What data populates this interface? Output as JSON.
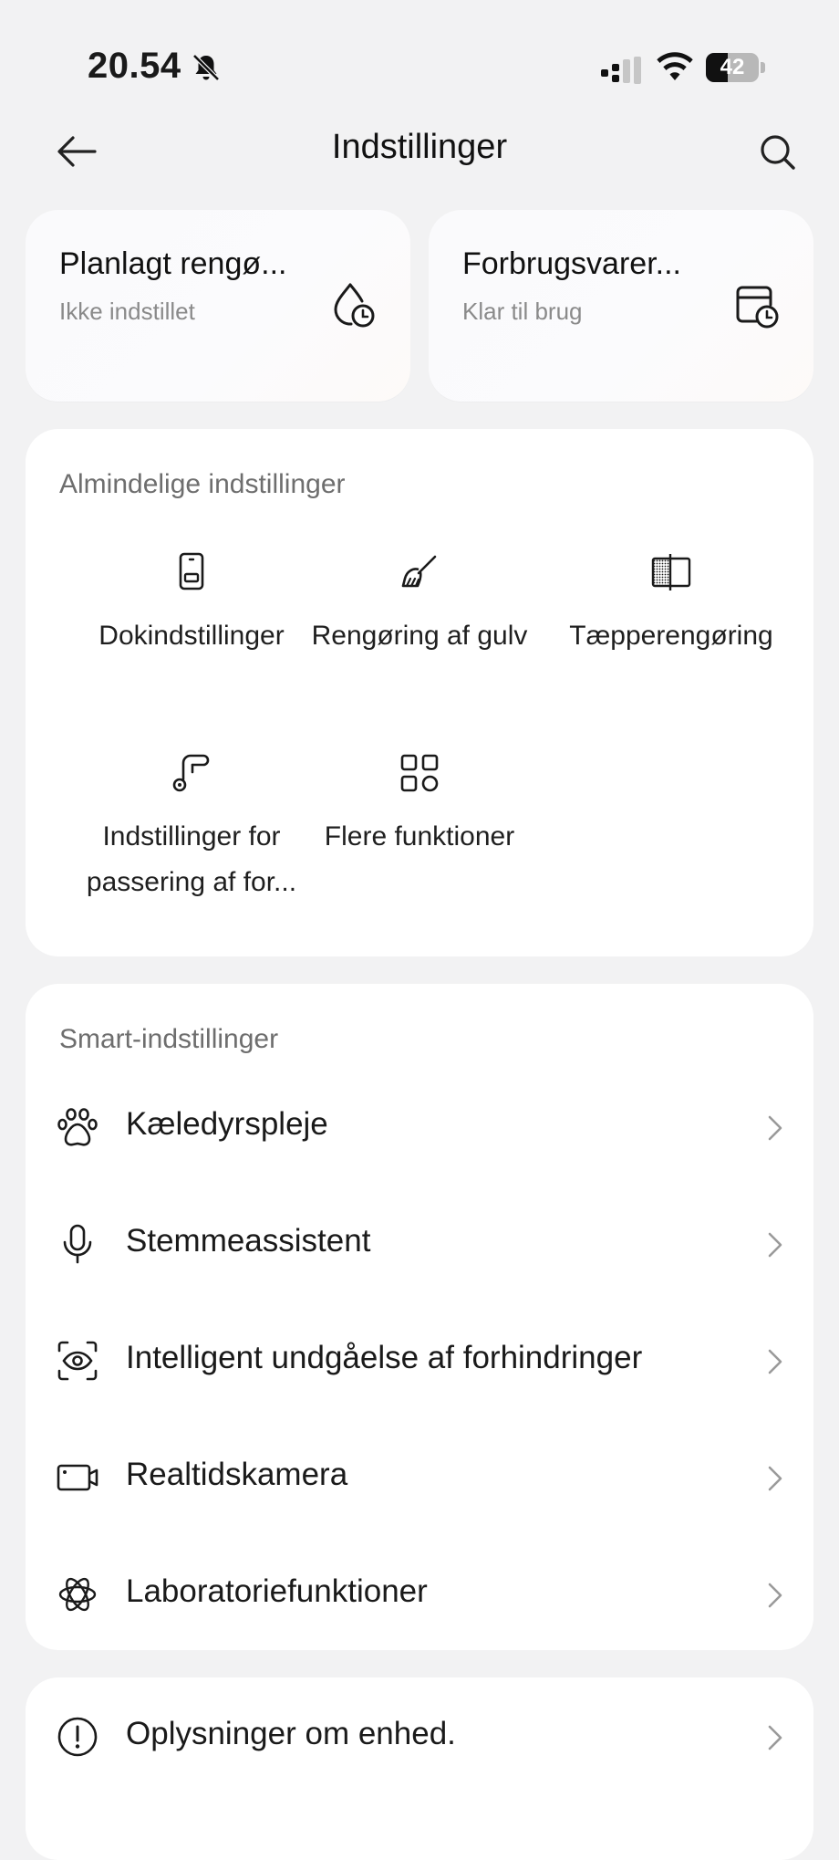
{
  "status_bar": {
    "time": "20.54",
    "battery_level": "42",
    "icons": [
      "bell-muted-icon",
      "signal-icon",
      "wifi-icon",
      "battery-icon"
    ]
  },
  "header": {
    "title": "Indstillinger",
    "icons": [
      "back-arrow-icon",
      "search-icon"
    ]
  },
  "top_cards": [
    {
      "title": "Planlagt rengø...",
      "subtitle": "Ikke indstillet",
      "icon": "drop-clock-icon"
    },
    {
      "title": "Forbrugsvarer...",
      "subtitle": "Klar til brug",
      "icon": "box-clock-icon"
    }
  ],
  "general": {
    "title": "Almindelige indstillinger",
    "items": [
      {
        "label": "Dokindstillinger",
        "icon": "dock-icon"
      },
      {
        "label": "Rengøring af gulv",
        "icon": "mop-icon"
      },
      {
        "label": "Tæpperengøring",
        "icon": "carpet-icon"
      },
      {
        "label_line1": "Indstillinger for",
        "label_line2": "passering af for...",
        "icon": "threshold-icon"
      },
      {
        "label": "Flere funktioner",
        "icon": "grid-icon"
      }
    ]
  },
  "smart": {
    "title": "Smart-indstillinger",
    "items": [
      {
        "label": "Kæledyrspleje",
        "icon": "paw-icon"
      },
      {
        "label": "Stemmeassistent",
        "icon": "microphone-icon"
      },
      {
        "label": "Intelligent undgåelse af forhindringer",
        "icon": "eye-scan-icon"
      },
      {
        "label": "Realtidskamera",
        "icon": "camera-icon"
      },
      {
        "label": "Laboratoriefunktioner",
        "icon": "lab-icon"
      }
    ]
  },
  "device": {
    "items": [
      {
        "label": "Oplysninger om enhed.",
        "icon": "info-icon"
      }
    ]
  },
  "colors": {
    "background": "#f2f2f3",
    "card": "#ffffff",
    "text": "#1a1a1a",
    "secondary_text": "#8a8a8a",
    "section_title": "#6e6e6e"
  }
}
